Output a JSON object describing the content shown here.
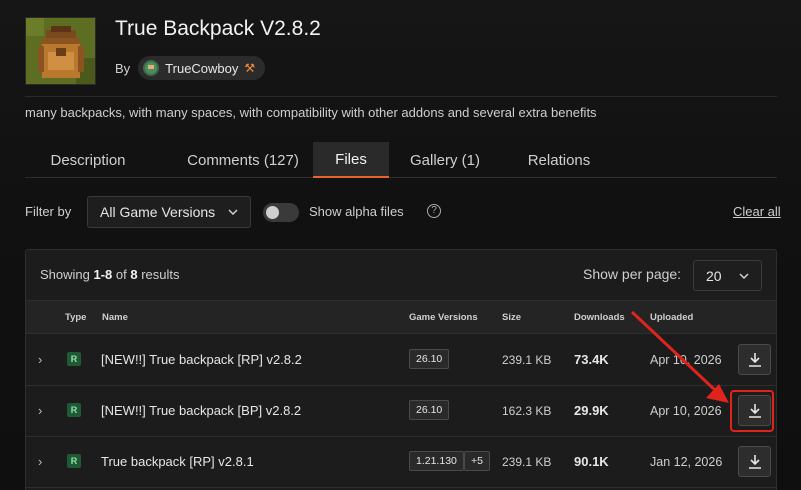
{
  "project": {
    "title": "True Backpack V2.8.2",
    "by_label": "By",
    "author": "TrueCowboy",
    "description": "many backpacks, with many spaces, with compatibility with other addons and several extra benefits"
  },
  "tabs": [
    {
      "label": "Description"
    },
    {
      "label": "Comments (127)"
    },
    {
      "label": "Files"
    },
    {
      "label": "Gallery (1)"
    },
    {
      "label": "Relations"
    }
  ],
  "filters": {
    "filter_label": "Filter by",
    "game_version_selected": "All Game Versions",
    "alpha_label": "Show alpha files",
    "alpha_enabled": false,
    "clear_all": "Clear all"
  },
  "results": {
    "showing_prefix": "Showing ",
    "range": "1-8",
    "of": " of ",
    "total": "8",
    "suffix": " results",
    "per_page_label": "Show per page:",
    "per_page_value": "20"
  },
  "table": {
    "headers": {
      "type": "Type",
      "name": "Name",
      "game_versions": "Game Versions",
      "size": "Size",
      "downloads": "Downloads",
      "uploaded": "Uploaded"
    },
    "rows": [
      {
        "type": "R",
        "name": "[NEW!!] True backpack [RP] v2.8.2",
        "version": "26.10",
        "extra": "",
        "size": "239.1 KB",
        "downloads": "73.4K",
        "uploaded": "Apr 10, 2026"
      },
      {
        "type": "R",
        "name": "[NEW!!] True backpack [BP] v2.8.2",
        "version": "26.10",
        "extra": "",
        "size": "162.3 KB",
        "downloads": "29.9K",
        "uploaded": "Apr 10, 2026"
      },
      {
        "type": "R",
        "name": "True backpack [RP] v2.8.1",
        "version": "1.21.130",
        "extra": "+5",
        "size": "239.1 KB",
        "downloads": "90.1K",
        "uploaded": "Jan 12, 2026"
      }
    ]
  },
  "colors": {
    "accent": "#e8642c",
    "highlight": "#e0241c",
    "release_badge": "#1f5a35"
  }
}
